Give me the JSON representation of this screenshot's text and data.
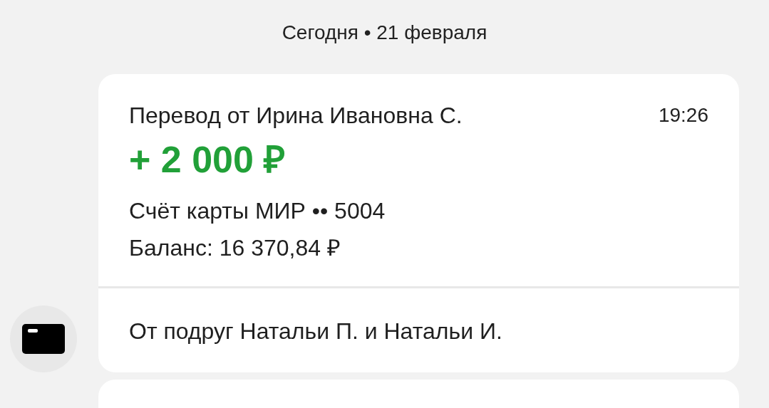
{
  "date_header": "Сегодня • 21 февраля",
  "transaction": {
    "title": "Перевод от Ирина Ивановна С.",
    "time": "19:26",
    "amount": "+ 2 000 ₽",
    "account": "Счёт карты МИР •• 5004",
    "balance": "Баланс: 16 370,84 ₽",
    "message": "От подруг Натальи П. и Натальи И."
  }
}
